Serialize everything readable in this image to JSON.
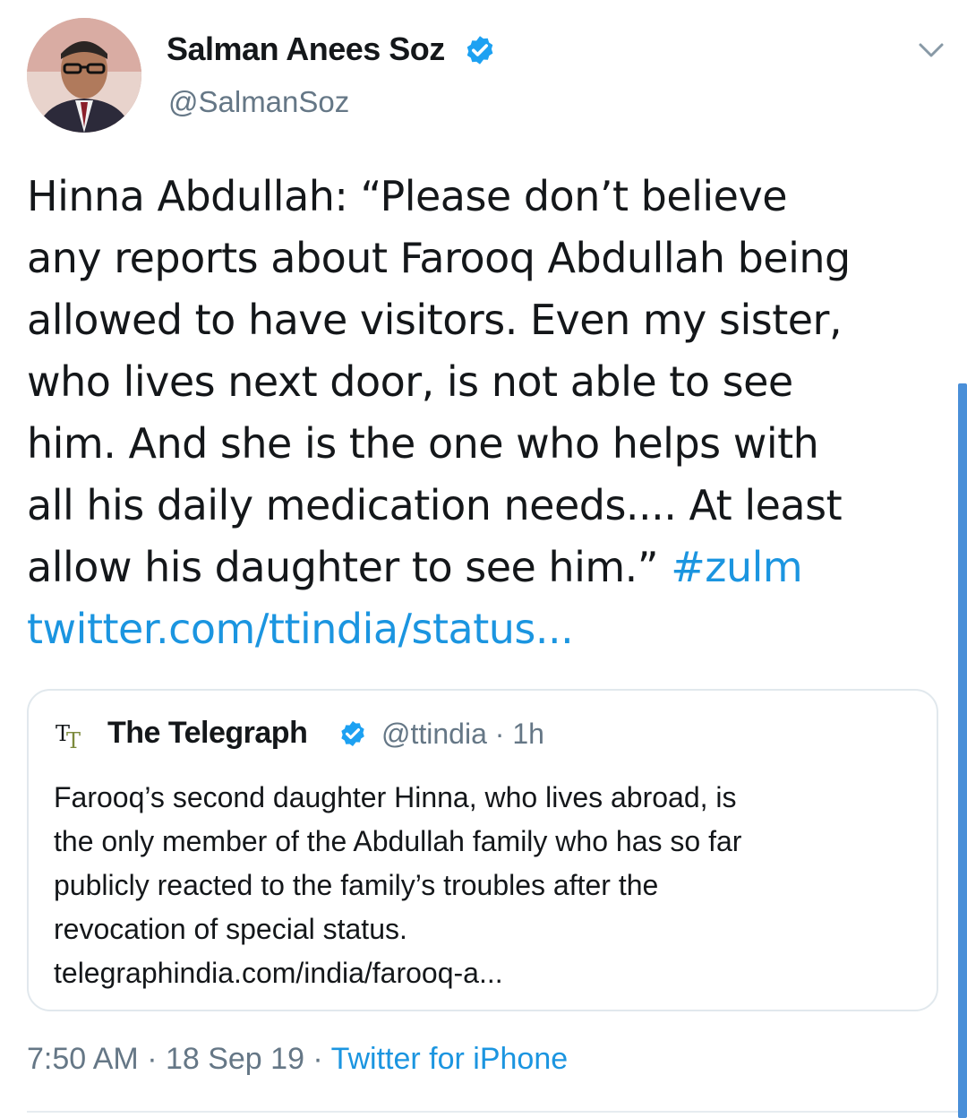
{
  "author": {
    "name": "Salman Anees Soz",
    "handle": "@SalmanSoz",
    "verified": true,
    "avatar_icon": "profile-photo"
  },
  "tweet": {
    "lines": [
      "Hinna Abdullah: “Please don’t believe",
      "any reports about Farooq Abdullah being",
      "allowed to have visitors. Even my sister,",
      "who lives next door, is not able to see",
      "him. And she is the one who helps with",
      "all his daily medication needs.... At least"
    ],
    "last_line_text": "allow his daughter to see him.” ",
    "hashtag": "#zulm",
    "link": "twitter.com/ttindia/status..."
  },
  "quoted_tweet": {
    "logo_text_1": "T",
    "logo_text_2": "T",
    "name": "The Telegraph",
    "verified": true,
    "meta": "@ttindia · 1h",
    "lines": [
      "Farooq’s second daughter Hinna, who lives abroad, is",
      "the only member of the Abdullah family who has so far",
      "publicly reacted to the family’s troubles after the",
      "revocation of special status.",
      "telegraphindia.com/india/farooq-a..."
    ]
  },
  "meta": {
    "timestamp": "7:50 AM · 18 Sep 19 · ",
    "source": "Twitter for iPhone"
  },
  "colors": {
    "link": "#1b95e0",
    "verified": "#1da1f2",
    "muted": "#657786",
    "text": "#14171a",
    "border": "#e1e8ed"
  }
}
